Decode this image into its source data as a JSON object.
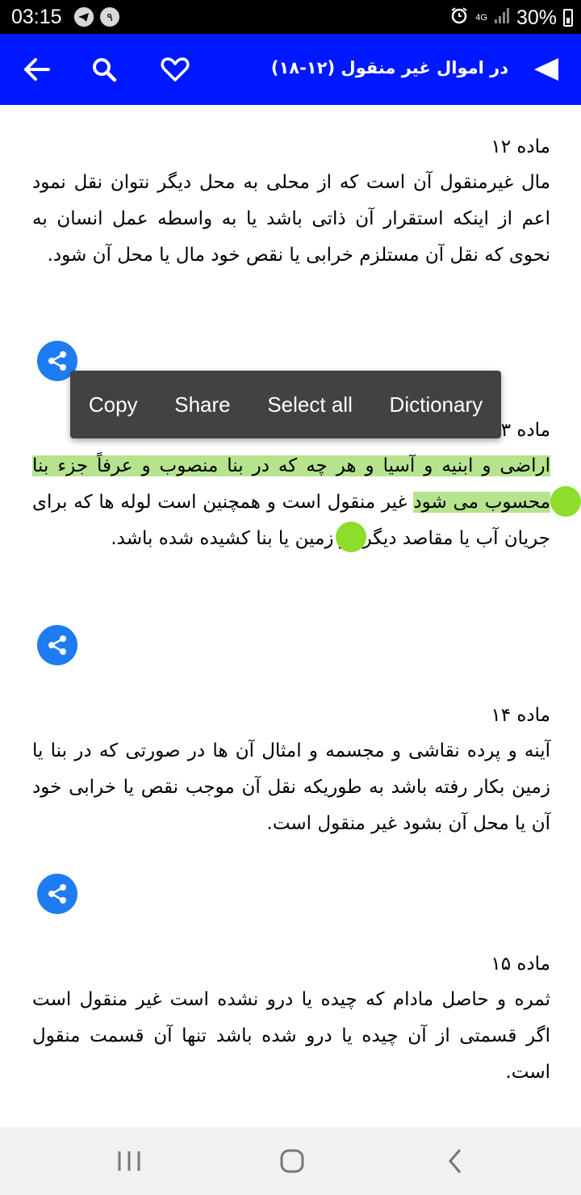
{
  "status_bar": {
    "time": "03:15",
    "notification_badge": "۹",
    "network": "4G",
    "battery": "30%",
    "icons": [
      "telegram-icon",
      "notification-badge-icon",
      "alarm-icon",
      "signal-icon",
      "battery-charging-icon"
    ]
  },
  "app_bar": {
    "title": "در اموال غیر منقول (۱۲-۱۸)",
    "icons": [
      "back-arrow-icon",
      "search-icon",
      "heart-icon",
      "play-icon"
    ]
  },
  "articles": [
    {
      "title": "ماده ۱۲",
      "text": "مال غیرمنقول آن است که از محلی به محل دیگر نتوان نقل نمود اعم از اینکه استقرار آن ذاتی باشد یا به واسطه عمل انسان به نحوی که نقل آن مستلزم خرابی یا نقص خود مال یا محل آن شود."
    },
    {
      "title": "ماده ۱۳",
      "text_selected": "اراضی و ابنیه و آسیا و هر چه که در بنا منصوب و عرفاً جزء بنا محسوب می شود",
      "text_rest": " غیر منقول است و همچنین است لوله ها که برای جریان آب یا مقاصد دیگر در زمین یا بنا کشیده شده باشد."
    },
    {
      "title": "ماده ۱۴",
      "text": "آینه و پرده نقاشی و مجسمه و امثال آن ها در صورتی که در بنا یا زمین بکار رفته باشد به طوریکه نقل آن موجب نقص یا خرابی خود آن یا محل آن بشود غیر منقول است."
    },
    {
      "title": "ماده ۱۵",
      "text": "ثمره و حاصل مادام که چیده یا درو نشده است غیر منقول است اگر قسمتی از آن چیده یا درو شده باشد تنها آن قسمت منقول است."
    }
  ],
  "context_menu": {
    "copy": "Copy",
    "share": "Share",
    "select_all": "Select all",
    "dictionary": "Dictionary"
  },
  "colors": {
    "app_bar": "#0018ff",
    "share_button": "#1e7cf2",
    "selection": "#b6e38e",
    "handle": "#8ddd2a",
    "context_menu": "#424242"
  }
}
